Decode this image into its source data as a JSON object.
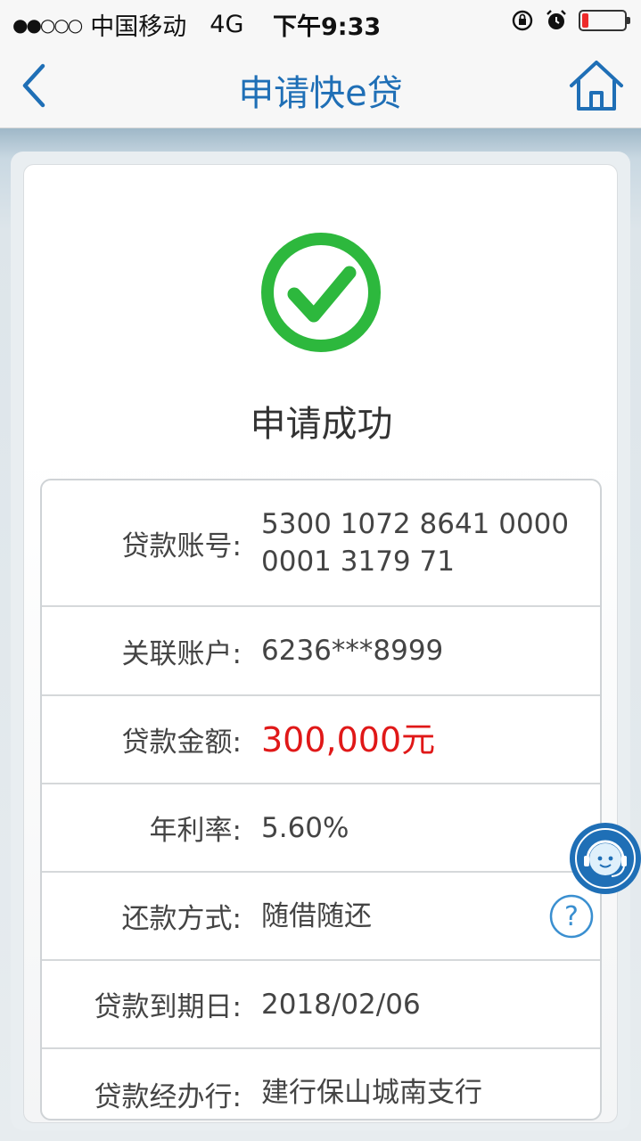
{
  "status_bar": {
    "signal": "●●○○○",
    "carrier": "中国移动",
    "network": "4G",
    "time": "下午9:33"
  },
  "nav": {
    "title": "申请快e贷",
    "back_icon": "chevron-left-icon",
    "home_icon": "home-icon"
  },
  "result": {
    "icon": "check-circle-icon",
    "message": "申请成功"
  },
  "details": [
    {
      "label": "贷款账号:",
      "value_line1": "5300 1072 8641 0000",
      "value_line2": "0001 3179 71"
    },
    {
      "label": "关联账户:",
      "value": "6236***8999"
    },
    {
      "label": "贷款金额:",
      "value": "300,000元"
    },
    {
      "label": "年利率:",
      "value": "5.60%"
    },
    {
      "label": "还款方式:",
      "value": "随借随还"
    },
    {
      "label": "贷款到期日:",
      "value": "2018/02/06"
    },
    {
      "label": "贷款经办行:",
      "value": "建行保山城南支行"
    }
  ],
  "colors": {
    "accent": "#1f6fb6",
    "success": "#2db83d",
    "amount": "#e01818"
  }
}
